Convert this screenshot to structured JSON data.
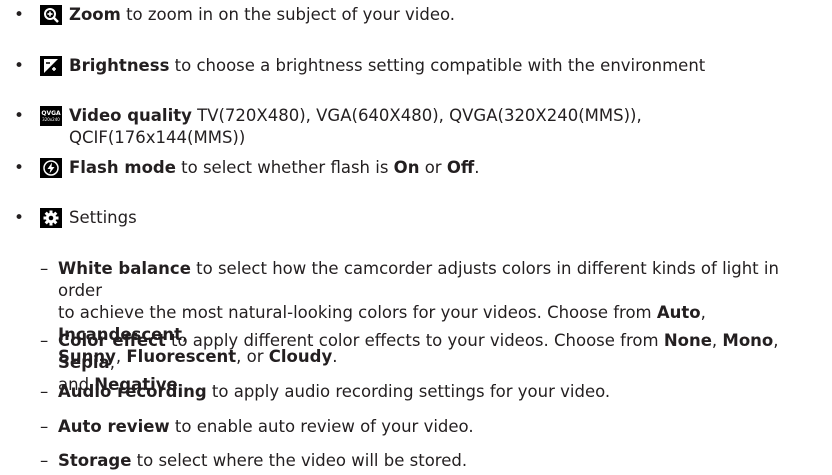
{
  "bullet_char": "•",
  "dash_char": "–",
  "items": [
    {
      "icon": "zoom-icon",
      "label": "Zoom",
      "text": " to zoom in on the subject of your video."
    },
    {
      "icon": "brightness-icon",
      "label": "Brightness",
      "text": " to choose a brightness setting compatible with the environment"
    },
    {
      "icon": "video-quality-icon",
      "icon_text": "QVGA",
      "icon_subtext": "320x240",
      "label": "Video quality",
      "text_line1": " TV(720X480), VGA(640X480), QVGA(320X240(MMS)),",
      "text_line2": "QCIF(176x144(MMS))"
    },
    {
      "icon": "flash-icon",
      "label": "Flash mode",
      "text_a": " to select whether flash is ",
      "on": "On",
      "text_b": " or ",
      "off": "Off",
      "text_c": "."
    },
    {
      "icon": "settings-icon",
      "label": "Settings"
    }
  ],
  "sub_items": {
    "white_balance": {
      "label": "White balance",
      "line1": " to select how the camcorder adjusts colors in different kinds of light in order",
      "line2a": "to achieve the most natural-looking colors for your videos. Choose from ",
      "auto": "Auto",
      "sep1": ", ",
      "incandescent": "Incandescent",
      "sep2": ",",
      "sunny": "Sunny",
      "sep3": ", ",
      "fluorescent": "Fluorescent",
      "sep4": ", or ",
      "cloudy": "Cloudy",
      "end": "."
    },
    "color_effect": {
      "label": "Color effect",
      "line1": " to apply different color effects to your videos. Choose from ",
      "none": "None",
      "sep1": ", ",
      "mono": "Mono",
      "sep2": ", ",
      "sepia": "Sepia",
      "sep3": ",",
      "line2a": "and ",
      "negative": "Negative",
      "end": "."
    },
    "audio_recording": {
      "label": "Audio recording",
      "text": " to apply audio recording settings for your video."
    },
    "auto_review": {
      "label": "Auto review",
      "text": " to enable auto review of your video."
    },
    "storage": {
      "label": "Storage",
      "text": " to select where the video will be stored."
    }
  }
}
